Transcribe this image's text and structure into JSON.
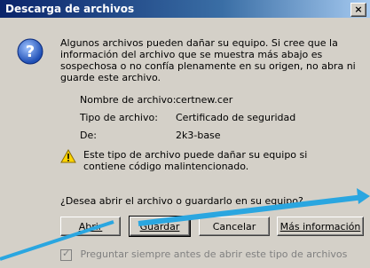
{
  "window": {
    "title": "Descarga de archivos",
    "close_label": "×"
  },
  "intro": "Algunos archivos pueden dañar su equipo. Si cree que la información del archivo que se muestra más abajo es sospechosa o no confía plenamente en su origen, no abra ni guarde este archivo.",
  "file_info": {
    "name_label": "Nombre de archivo:",
    "name_value": "certnew.cer",
    "type_label": "Tipo de archivo:",
    "type_value": "Certificado de seguridad",
    "from_label": "De:",
    "from_value": "2k3-base"
  },
  "warning": "Este tipo de archivo puede dañar su equipo si contiene código malintencionado.",
  "question": "¿Desea abrir el archivo o guardarlo en su equipo?",
  "buttons": {
    "open": "Abrir",
    "save": "Guardar",
    "cancel": "Cancelar",
    "more_info": "Más información"
  },
  "checkbox": {
    "label": "Preguntar siempre antes de abrir este tipo de archivos",
    "checked": true
  },
  "colors": {
    "titlebar_start": "#0a246a",
    "dialog_bg": "#d4d0c8",
    "arrow": "#2aa6e0"
  }
}
